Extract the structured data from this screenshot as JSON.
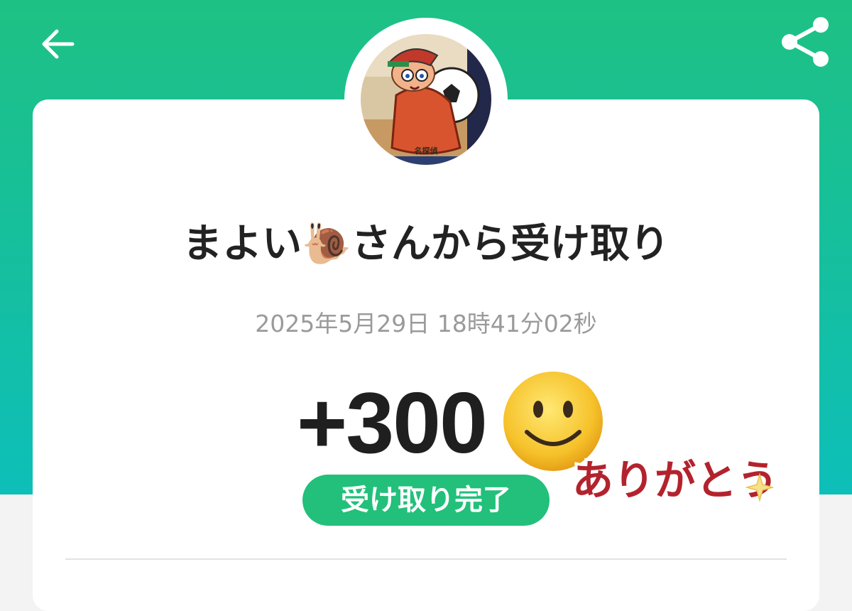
{
  "header": {
    "back_icon": "arrow-left-icon",
    "share_icon": "share-icon"
  },
  "avatar": {
    "caption": "名探偵"
  },
  "transaction": {
    "sender_name": "まよい",
    "sender_emoji": "🐌",
    "sender_suffix": "さんから受け取り",
    "timestamp": "2025年5月29日 18時41分02秒",
    "amount": "+300",
    "status": "受け取り完了"
  },
  "sticker": {
    "emoji_icon": "smiling-face-icon",
    "thanks_text": "ありがとう"
  },
  "colors": {
    "header_green": "#1ec184",
    "header_teal": "#0dbfb9",
    "badge_green": "#22c07a",
    "sticker_red": "#b3232d"
  }
}
